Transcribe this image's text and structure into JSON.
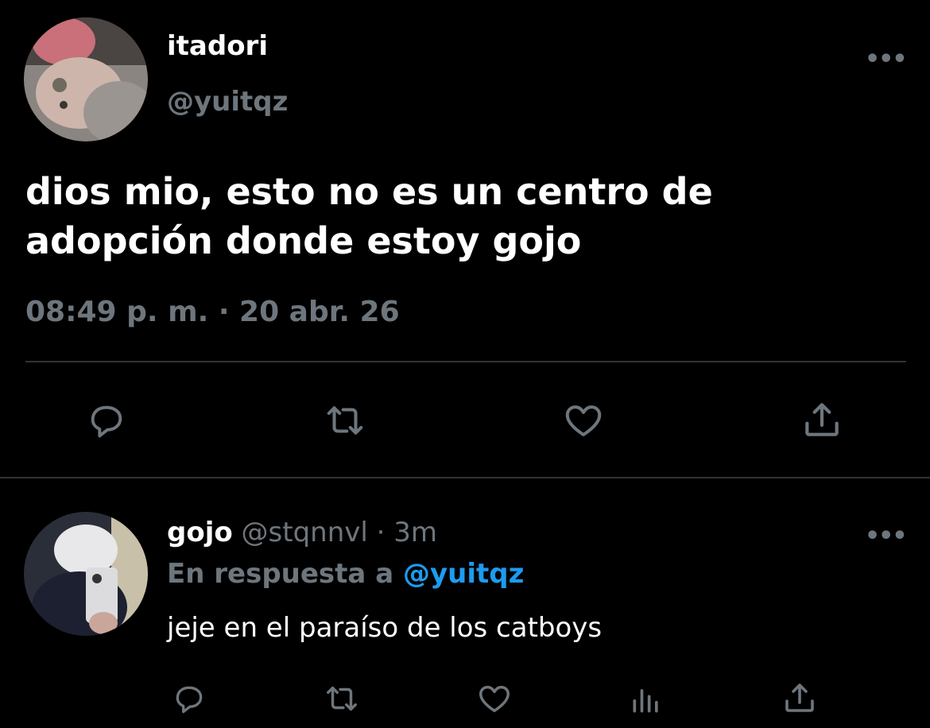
{
  "tweet": {
    "display_name": "itadori",
    "handle": "@yuitqz",
    "text_line1": "dios mio, esto no es un centro de",
    "text_line2": "adopción donde estoy gojo",
    "timestamp": "08:49 p. m. · 20 abr. 26",
    "more_label": "•••"
  },
  "reply": {
    "display_name": "gojo",
    "handle": "@stqnnvl",
    "separator": "·",
    "time": "3m",
    "in_reply_prefix": "En respuesta a",
    "in_reply_mention": "@yuitqz",
    "text": "jeje en el paraíso de los catboys",
    "more_label": "•••"
  },
  "icons": {
    "reply": "reply-icon",
    "retweet": "retweet-icon",
    "like": "heart-icon",
    "share": "share-icon",
    "analytics": "analytics-icon"
  },
  "colors": {
    "background": "#000000",
    "text": "#ffffff",
    "muted": "#6e767d",
    "accent": "#1d9bf0",
    "divider": "#2f3336"
  }
}
